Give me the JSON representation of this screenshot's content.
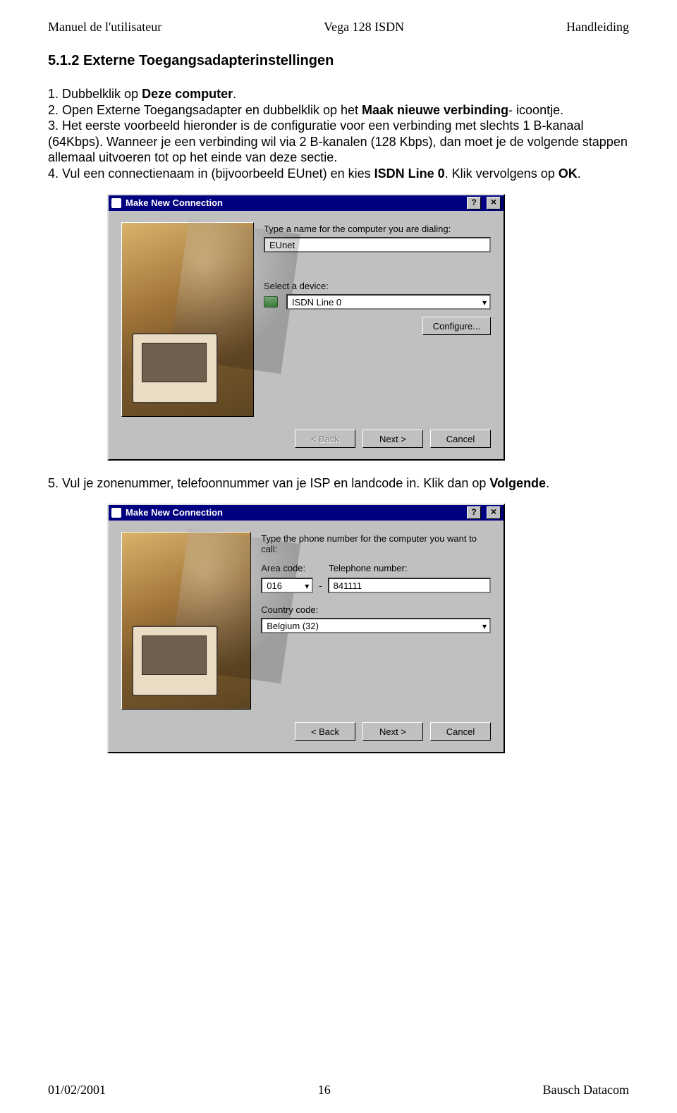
{
  "header": {
    "left": "Manuel de l'utilisateur",
    "center": "Vega 128 ISDN",
    "right": "Handleiding"
  },
  "section_title": "5.1.2 Externe Toegangsadapterinstellingen",
  "steps": {
    "s1_num": "1. ",
    "s1a": "Dubbelklik op ",
    "s1b_bold": "Deze computer",
    "s1c": ".",
    "s2_num": "2. ",
    "s2a": "Open Externe Toegangsadapter en dubbelklik op het ",
    "s2b_bold": "Maak nieuwe verbinding",
    "s2c": "- icoontje.",
    "s3_num": "3. ",
    "s3": "Het eerste voorbeeld hieronder is de configuratie voor een verbinding met slechts 1 B-kanaal (64Kbps). Wanneer je een verbinding wil via 2 B-kanalen (128 Kbps), dan moet je de volgende stappen allemaal uitvoeren tot op het einde van deze sectie.",
    "s4_num": "4. ",
    "s4a": "Vul een connectienaam in (bijvoorbeeld EUnet) en kies ",
    "s4b_bold": "ISDN Line 0",
    "s4c": ". Klik vervolgens op ",
    "s4d_bold": "OK",
    "s4e": ".",
    "s5_num": "5. ",
    "s5a": "Vul je zonenummer, telefoonnummer van je ISP en landcode in. Klik dan op ",
    "s5b_bold": "Volgende",
    "s5c": "."
  },
  "dialog1": {
    "title": "Make New Connection",
    "help": "?",
    "close": "×",
    "label_name": "Type a name for the computer you are dialing:",
    "name_value": "EUnet",
    "label_device": "Select a device:",
    "device_value": "ISDN Line 0",
    "configure_btn": "Configure...",
    "back_btn": "< Back",
    "next_btn": "Next >",
    "cancel_btn": "Cancel"
  },
  "dialog2": {
    "title": "Make New Connection",
    "help": "?",
    "close": "×",
    "label_phone": "Type the phone number for the computer you want to call:",
    "label_area": "Area code:",
    "label_tel": "Telephone number:",
    "area_value": "016",
    "tel_value": "841111",
    "label_country": "Country code:",
    "country_value": "Belgium (32)",
    "back_btn": "< Back",
    "next_btn": "Next >",
    "cancel_btn": "Cancel"
  },
  "footer": {
    "left": "01/02/2001",
    "center": "16",
    "right": "Bausch Datacom"
  }
}
